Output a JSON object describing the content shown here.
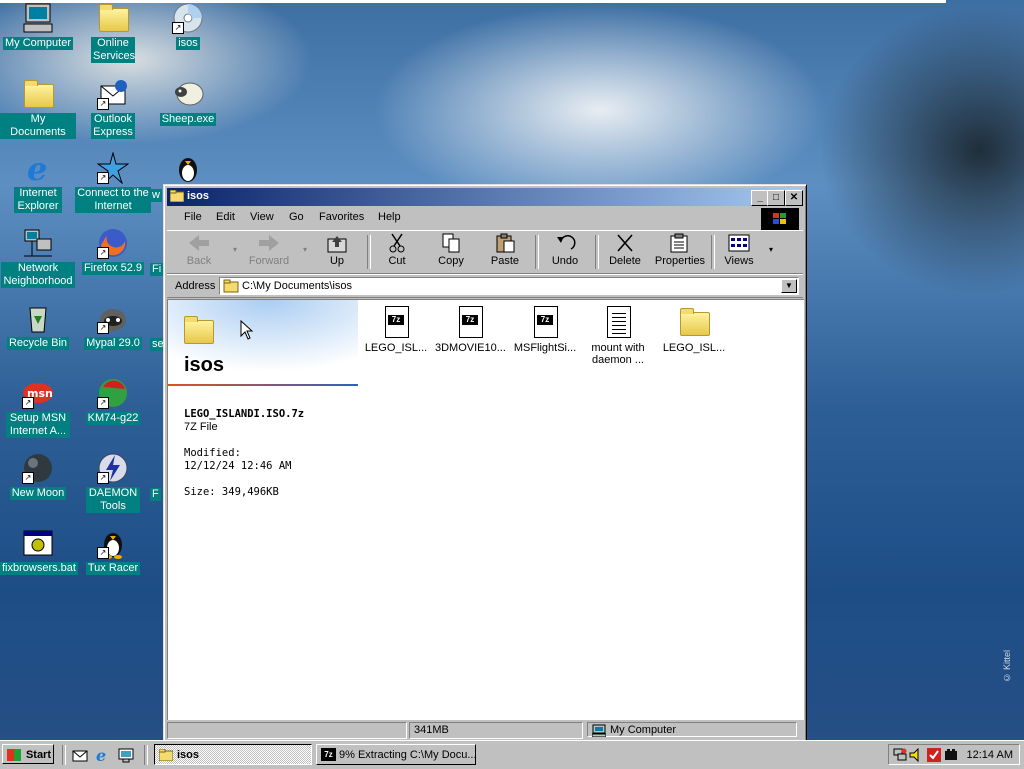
{
  "desktop": {
    "icons": [
      {
        "label": "My Computer",
        "icon": "my-computer-icon"
      },
      {
        "label": "Online Services",
        "icon": "folder-icon"
      },
      {
        "label": "isos",
        "icon": "cd-icon"
      },
      {
        "label": "My Documents",
        "icon": "my-documents-icon"
      },
      {
        "label": "Outlook Express",
        "icon": "outlook-express-icon"
      },
      {
        "label": "Sheep.exe",
        "icon": "sheep-icon"
      },
      {
        "label": "Internet Explorer",
        "icon": "internet-explorer-icon"
      },
      {
        "label": "Connect to the Internet",
        "icon": "connect-internet-icon"
      },
      {
        "label": "Network Neighborhood",
        "icon": "network-icon"
      },
      {
        "label": "Firefox 52.9",
        "icon": "firefox-icon"
      },
      {
        "label": "Recycle Bin",
        "icon": "recycle-bin-icon"
      },
      {
        "label": "Mypal 29.0",
        "icon": "mypal-icon"
      },
      {
        "label": "Setup MSN Internet A...",
        "icon": "msn-icon"
      },
      {
        "label": "KM74-g22",
        "icon": "km74-icon"
      },
      {
        "label": "New Moon",
        "icon": "new-moon-icon"
      },
      {
        "label": "DAEMON Tools",
        "icon": "daemon-tools-icon"
      },
      {
        "label": "fixbrowsers.bat",
        "icon": "batch-file-icon"
      },
      {
        "label": "Tux Racer",
        "icon": "tux-icon"
      }
    ],
    "partial": [
      "w",
      "Fi",
      "se",
      "F"
    ]
  },
  "window": {
    "title": "isos",
    "menu": [
      "File",
      "Edit",
      "View",
      "Go",
      "Favorites",
      "Help"
    ],
    "toolbar": [
      {
        "label": "Back",
        "icon": "back-arrow-icon",
        "enabled": false
      },
      {
        "label": "Forward",
        "icon": "forward-arrow-icon",
        "enabled": false
      },
      {
        "label": "Up",
        "icon": "up-folder-icon",
        "enabled": true
      },
      {
        "label": "Cut",
        "icon": "scissors-icon",
        "enabled": true
      },
      {
        "label": "Copy",
        "icon": "copy-icon",
        "enabled": true
      },
      {
        "label": "Paste",
        "icon": "paste-icon",
        "enabled": true
      },
      {
        "label": "Undo",
        "icon": "undo-icon",
        "enabled": true
      },
      {
        "label": "Delete",
        "icon": "delete-x-icon",
        "enabled": true
      },
      {
        "label": "Properties",
        "icon": "properties-icon",
        "enabled": true
      },
      {
        "label": "Views",
        "icon": "views-icon",
        "enabled": true
      }
    ],
    "address": {
      "label": "Address",
      "value": "C:\\My Documents\\isos"
    },
    "left_pane": {
      "folder_title": "isos",
      "selected_name": "LEGO_ISLANDI.ISO.7z",
      "selected_type": "7Z File",
      "modified_label": "Modified:",
      "modified_value": "12/12/24 12:46 AM",
      "size": "Size: 349,496KB"
    },
    "files": [
      {
        "label": "LEGO_ISL...",
        "icon": "7z-file-icon",
        "badge": "7z"
      },
      {
        "label": "3DMOVIE10...",
        "icon": "7z-file-icon",
        "badge": "7z"
      },
      {
        "label": "MSFlightSi...",
        "icon": "7z-file-icon",
        "badge": "7z"
      },
      {
        "label": "mount with daemon ...",
        "icon": "text-file-icon"
      },
      {
        "label": "LEGO_ISL...",
        "icon": "folder-icon"
      }
    ],
    "status": {
      "size": "341MB",
      "location": "My Computer"
    }
  },
  "taskbar": {
    "start": "Start",
    "tasks": [
      {
        "label": "isos",
        "active": true
      },
      {
        "label": "9% Extracting C:\\My Docu...",
        "active": false
      }
    ],
    "clock": "12:14 AM"
  },
  "watermark": "© Kittel"
}
